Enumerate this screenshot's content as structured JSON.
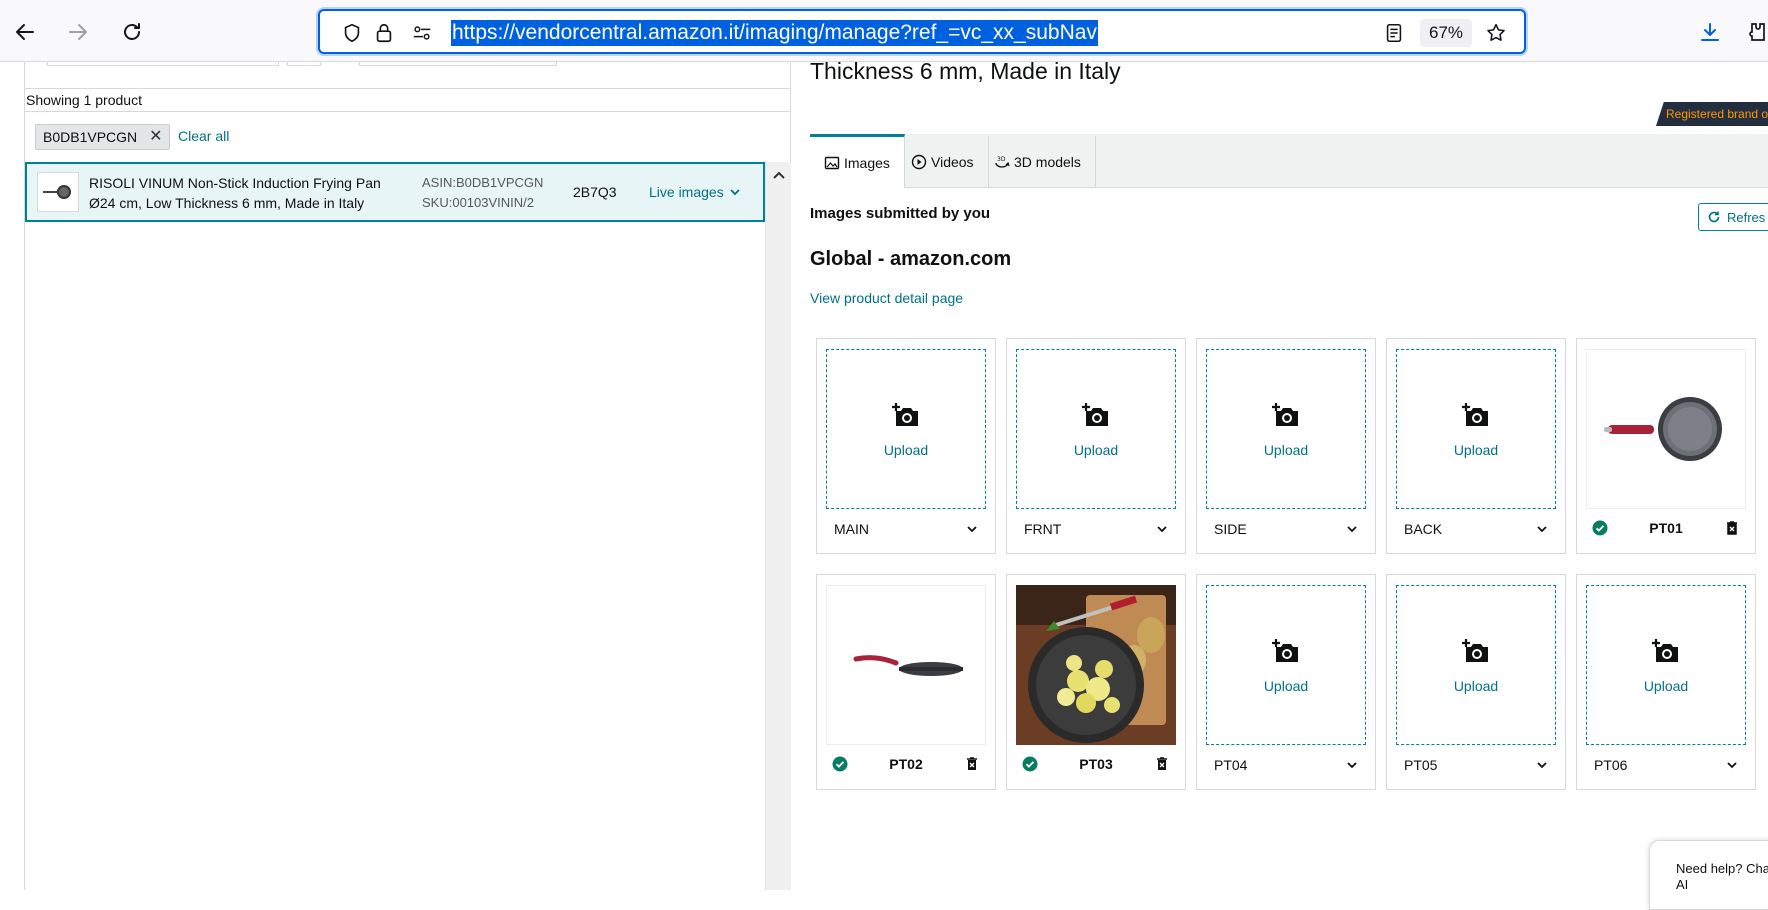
{
  "browser": {
    "url": "https://vendorcentral.amazon.it/imaging/manage?ref_=vc_xx_subNav",
    "zoom": "67%"
  },
  "left": {
    "showing": "Showing 1 product",
    "filter_chip": "B0DB1VPCGN",
    "clear_all": "Clear all",
    "product": {
      "title": "RISOLI VINUM Non-Stick Induction Frying Pan Ø24 cm, Low Thickness 6 mm, Made in Italy",
      "asin": "ASIN:B0DB1VPCGN",
      "sku": "SKU:00103VININ/2",
      "code": "2B7Q3",
      "live_images": "Live images"
    }
  },
  "right": {
    "title": "Thickness 6 mm, Made in Italy",
    "brand_badge": "Registered brand o",
    "tabs": [
      {
        "label": "Images"
      },
      {
        "label": "Videos"
      },
      {
        "label": "3D models"
      }
    ],
    "submitted_heading": "Images submitted by you",
    "refresh": "Refres",
    "marketplace": "Global - amazon.com",
    "view_pdp": "View product detail page",
    "upload_label": "Upload",
    "slots": [
      {
        "variant": "MAIN"
      },
      {
        "variant": "FRNT"
      },
      {
        "variant": "SIDE"
      },
      {
        "variant": "BACK"
      },
      {
        "variant": "PT01"
      },
      {
        "variant": "PT02"
      },
      {
        "variant": "PT03"
      },
      {
        "variant": "PT04"
      },
      {
        "variant": "PT05"
      },
      {
        "variant": "PT06"
      }
    ],
    "help": {
      "line1": "Need help? Cha",
      "line2": "AI"
    }
  },
  "colors": {
    "teal": "#008296",
    "link": "#007185",
    "url_highlight": "#0061e0",
    "success": "#067d62"
  }
}
